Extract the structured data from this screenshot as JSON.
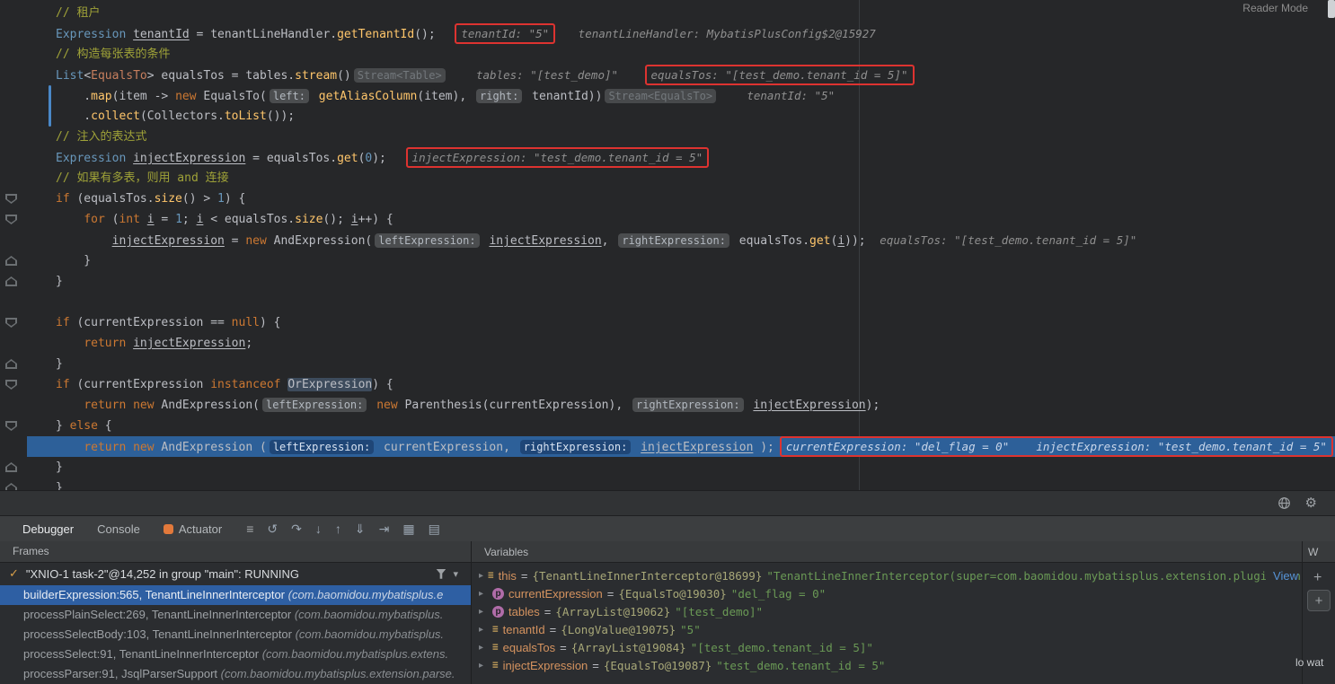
{
  "icons": {
    "chevron_right": "▸",
    "caret_down": "▾",
    "var_bars": "≡",
    "param_letter": "p",
    "plus": "+",
    "thread_check": "✓",
    "gear": "⚙"
  },
  "editor": {
    "reader_mode_label": "Reader Mode",
    "exec_line": 22,
    "gutter_marks": [
      {
        "line": 10,
        "dir": "down"
      },
      {
        "line": 11,
        "dir": "down"
      },
      {
        "line": 13,
        "dir": "up"
      },
      {
        "line": 14,
        "dir": "up"
      },
      {
        "line": 16,
        "dir": "down"
      },
      {
        "line": 18,
        "dir": "up"
      },
      {
        "line": 19,
        "dir": "down"
      },
      {
        "line": 21,
        "dir": "down"
      },
      {
        "line": 23,
        "dir": "up"
      },
      {
        "line": 24,
        "dir": "up"
      }
    ],
    "lines": [
      [
        [
          "cm",
          "// 租户"
        ]
      ],
      [
        [
          "tb",
          "Expression"
        ],
        [
          "df",
          " "
        ],
        [
          "un",
          "tenantId"
        ],
        [
          "df",
          " = tenantLineHandler."
        ],
        [
          "fn",
          "getTenantId"
        ],
        [
          "df",
          "();"
        ],
        [
          "sp",
          "  "
        ],
        [
          "hintbox",
          "tenantId: \"5\""
        ],
        [
          "sp",
          "   "
        ],
        [
          "hint",
          "tenantLineHandler: MybatisPlusConfig$2@15927"
        ]
      ],
      [
        [
          "cm",
          "// 构造每张表的条件"
        ]
      ],
      [
        [
          "tb",
          "List"
        ],
        [
          "df",
          "<"
        ],
        [
          "tr",
          "EqualsTo"
        ],
        [
          "df",
          "> equalsTos = tables."
        ],
        [
          "fn",
          "stream"
        ],
        [
          "df",
          "()"
        ],
        [
          "chipg",
          "Stream<Table>"
        ],
        [
          "sp",
          "    "
        ],
        [
          "hint",
          "tables: \"[test_demo]\""
        ],
        [
          "sp",
          "   "
        ],
        [
          "hintbox",
          "equalsTos: \"[test_demo.tenant_id = 5]\""
        ]
      ],
      [
        [
          "df",
          "    ."
        ],
        [
          "fn",
          "map"
        ],
        [
          "df",
          "(item -> "
        ],
        [
          "kw",
          "new"
        ],
        [
          "df",
          " EqualsTo("
        ],
        [
          "chip",
          "left:"
        ],
        [
          "df",
          " "
        ],
        [
          "fn",
          "getAliasColumn"
        ],
        [
          "df",
          "(item), "
        ],
        [
          "chip",
          "right:"
        ],
        [
          "df",
          " tenantId))"
        ],
        [
          "chipg",
          "Stream<EqualsTo>"
        ],
        [
          "sp",
          "    "
        ],
        [
          "hint",
          "tenantId: \"5\""
        ]
      ],
      [
        [
          "df",
          "    ."
        ],
        [
          "fn",
          "collect"
        ],
        [
          "df",
          "(Collectors."
        ],
        [
          "fn",
          "toList"
        ],
        [
          "df",
          "());"
        ]
      ],
      [
        [
          "cm",
          "// 注入的表达式"
        ]
      ],
      [
        [
          "tb",
          "Expression"
        ],
        [
          "df",
          " "
        ],
        [
          "un",
          "injectExpression"
        ],
        [
          "df",
          " = equalsTos."
        ],
        [
          "fn",
          "get"
        ],
        [
          "df",
          "("
        ],
        [
          "nu",
          "0"
        ],
        [
          "df",
          ");"
        ],
        [
          "sp",
          "  "
        ],
        [
          "hintbox",
          "injectExpression: \"test_demo.tenant_id = 5\""
        ]
      ],
      [
        [
          "cm",
          "// 如果有多表，则用 and 连接"
        ]
      ],
      [
        [
          "kw",
          "if"
        ],
        [
          "df",
          " (equalsTos."
        ],
        [
          "fn",
          "size"
        ],
        [
          "df",
          "() > "
        ],
        [
          "nu",
          "1"
        ],
        [
          "df",
          ") {"
        ]
      ],
      [
        [
          "df",
          "    "
        ],
        [
          "kw",
          "for"
        ],
        [
          "df",
          " ("
        ],
        [
          "kw",
          "int"
        ],
        [
          "df",
          " "
        ],
        [
          "un",
          "i"
        ],
        [
          "df",
          " = "
        ],
        [
          "nu",
          "1"
        ],
        [
          "df",
          "; "
        ],
        [
          "un",
          "i"
        ],
        [
          "df",
          " < equalsTos."
        ],
        [
          "fn",
          "size"
        ],
        [
          "df",
          "(); "
        ],
        [
          "un",
          "i"
        ],
        [
          "df",
          "++) {"
        ]
      ],
      [
        [
          "df",
          "        "
        ],
        [
          "un",
          "injectExpression"
        ],
        [
          "df",
          " = "
        ],
        [
          "kw",
          "new"
        ],
        [
          "df",
          " AndExpression("
        ],
        [
          "chip",
          "leftExpression:"
        ],
        [
          "df",
          " "
        ],
        [
          "un",
          "injectExpression"
        ],
        [
          "df",
          ", "
        ],
        [
          "chip",
          "rightExpression:"
        ],
        [
          "df",
          " equalsTos."
        ],
        [
          "fn",
          "get"
        ],
        [
          "df",
          "("
        ],
        [
          "un",
          "i"
        ],
        [
          "df",
          "));"
        ],
        [
          "sp",
          "  "
        ],
        [
          "hint",
          "equalsTos: \"[test_demo.tenant_id = 5]\""
        ]
      ],
      [
        [
          "df",
          "    }"
        ]
      ],
      [
        [
          "df",
          "}"
        ]
      ],
      [],
      [
        [
          "kw",
          "if"
        ],
        [
          "df",
          " (currentExpression == "
        ],
        [
          "kw",
          "null"
        ],
        [
          "df",
          ") {"
        ]
      ],
      [
        [
          "df",
          "    "
        ],
        [
          "kw",
          "return"
        ],
        [
          "df",
          " "
        ],
        [
          "un",
          "injectExpression"
        ],
        [
          "df",
          ";"
        ]
      ],
      [
        [
          "df",
          "}"
        ]
      ],
      [
        [
          "kw",
          "if"
        ],
        [
          "df",
          " (currentExpression "
        ],
        [
          "kw",
          "instanceof"
        ],
        [
          "df",
          " "
        ],
        [
          "oc",
          "OrExpression"
        ],
        [
          "df",
          ") {"
        ]
      ],
      [
        [
          "df",
          "    "
        ],
        [
          "kw",
          "return"
        ],
        [
          "df",
          " "
        ],
        [
          "kw",
          "new"
        ],
        [
          "df",
          " AndExpression("
        ],
        [
          "chip",
          "leftExpression:"
        ],
        [
          "df",
          " "
        ],
        [
          "kw",
          "new"
        ],
        [
          "df",
          " Parenthesis(currentExpression), "
        ],
        [
          "chip",
          "rightExpression:"
        ],
        [
          "df",
          " "
        ],
        [
          "un",
          "injectExpression"
        ],
        [
          "df",
          ");"
        ]
      ],
      [
        [
          "df",
          "} "
        ],
        [
          "kw",
          "else"
        ],
        [
          "df",
          " {"
        ]
      ],
      [
        [
          "df",
          "    "
        ],
        [
          "kw",
          "return"
        ],
        [
          "df",
          " "
        ],
        [
          "kw",
          "new"
        ],
        [
          "df",
          " AndExpression ("
        ],
        [
          "chip",
          "leftExpression:"
        ],
        [
          "df",
          " currentExpression, "
        ],
        [
          "chip",
          "rightExpression:"
        ],
        [
          "df",
          " "
        ],
        [
          "un",
          "injectExpression"
        ],
        [
          "df",
          " );"
        ],
        [
          "hintbox",
          "currentExpression: \"del_flag = 0\"    injectExpression: \"test_demo.tenant_id = 5\""
        ]
      ],
      [
        [
          "df",
          "}"
        ]
      ],
      [
        [
          "df",
          "}"
        ]
      ]
    ]
  },
  "debug": {
    "tabs": [
      {
        "label": "Debugger",
        "active": true
      },
      {
        "label": "Console",
        "active": false
      },
      {
        "label": "Actuator",
        "active": false,
        "icon": "actuator-icon"
      }
    ],
    "toolbar_icons": [
      {
        "name": "hamburger-menu-icon",
        "glyph": "≡"
      },
      {
        "name": "resume-icon",
        "glyph": "↺"
      },
      {
        "name": "step-over-icon",
        "glyph": "↷"
      },
      {
        "name": "step-into-icon",
        "glyph": "↓"
      },
      {
        "name": "step-out-icon",
        "glyph": "↑"
      },
      {
        "name": "force-step-icon",
        "glyph": "⇓"
      },
      {
        "name": "run-to-cursor-icon",
        "glyph": "⇥"
      },
      {
        "name": "view-breakpoints-icon",
        "glyph": "▦"
      },
      {
        "name": "layout-settings-icon",
        "glyph": "▤"
      }
    ],
    "frames": {
      "title": "Frames",
      "thread": "\"XNIO-1 task-2\"@14,252 in group \"main\": RUNNING",
      "items": [
        {
          "method": "builderExpression:565, TenantLineInnerInterceptor ",
          "pkg": "(com.baomidou.mybatisplus.e",
          "selected": true
        },
        {
          "method": "processPlainSelect:269, TenantLineInnerInterceptor ",
          "pkg": "(com.baomidou.mybatisplus.",
          "selected": false
        },
        {
          "method": "processSelectBody:103, TenantLineInnerInterceptor ",
          "pkg": "(com.baomidou.mybatisplus.",
          "selected": false
        },
        {
          "method": "processSelect:91, TenantLineInnerInterceptor ",
          "pkg": "(com.baomidou.mybatisplus.extens.",
          "selected": false
        },
        {
          "method": "processParser:91, JsqlParserSupport ",
          "pkg": "(com.baomidou.mybatisplus.extension.parse.",
          "selected": false
        }
      ]
    },
    "variables": {
      "title": "Variables",
      "items": [
        {
          "kind": "var",
          "name": "this",
          "ref": "{TenantLineInnerInterceptor@18699}",
          "value": "\"TenantLineInnerInterceptor(super=com.baomidou.mybatisplus.extension.plugins.inner.Tena…\"",
          "link": "View"
        },
        {
          "kind": "param",
          "name": "currentExpression",
          "ref": "{EqualsTo@19030}",
          "value": "\"del_flag = 0\""
        },
        {
          "kind": "param",
          "name": "tables",
          "ref": "{ArrayList@19062}",
          "value": "\"[test_demo]\""
        },
        {
          "kind": "var",
          "name": "tenantId",
          "ref": "{LongValue@19075}",
          "value": "\"5\""
        },
        {
          "kind": "var",
          "name": "equalsTos",
          "ref": "{ArrayList@19084}",
          "value": "\"[test_demo.tenant_id = 5]\""
        },
        {
          "kind": "var",
          "name": "injectExpression",
          "ref": "{EqualsTo@19087}",
          "value": "\"test_demo.tenant_id = 5\""
        }
      ]
    },
    "watches": {
      "title": "W",
      "partial_text": "lo wat"
    }
  }
}
